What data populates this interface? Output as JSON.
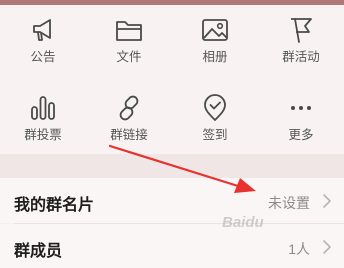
{
  "grid": {
    "row1": [
      {
        "label": "公告",
        "icon": "megaphone-icon"
      },
      {
        "label": "文件",
        "icon": "folder-icon"
      },
      {
        "label": "相册",
        "icon": "photo-icon"
      },
      {
        "label": "群活动",
        "icon": "flag-icon"
      }
    ],
    "row2": [
      {
        "label": "群投票",
        "icon": "vote-bars-icon"
      },
      {
        "label": "群链接",
        "icon": "link-icon"
      },
      {
        "label": "签到",
        "icon": "checkin-pin-icon"
      },
      {
        "label": "更多",
        "icon": "more-dots-icon"
      }
    ]
  },
  "list": {
    "card": {
      "title": "我的群名片",
      "value": "未设置"
    },
    "members": {
      "title": "群成员",
      "value": "1人"
    }
  },
  "annotation": {
    "color": "#e8322f"
  },
  "watermark": {
    "text": "Baidu经验"
  }
}
